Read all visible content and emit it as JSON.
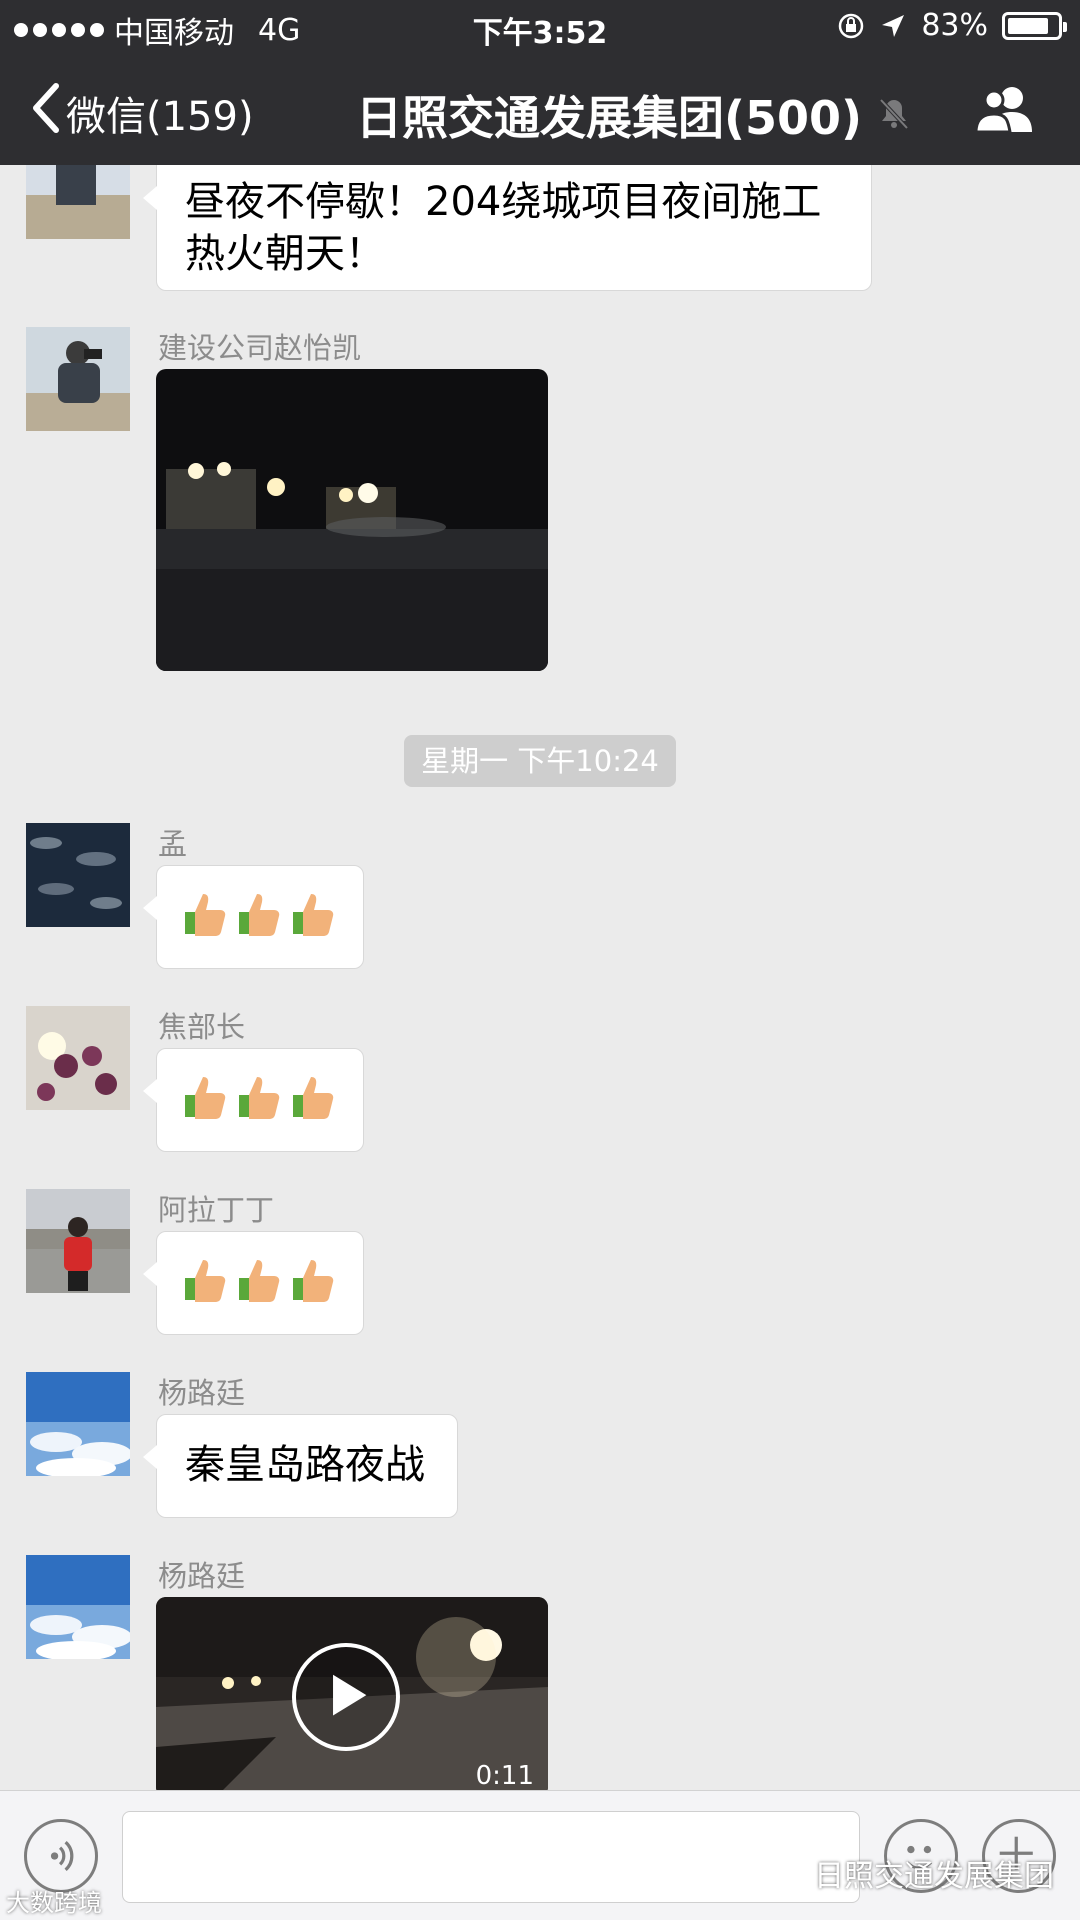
{
  "status_bar": {
    "carrier": "中国移动",
    "network": "4G",
    "time": "下午3:52",
    "battery": "83%",
    "battery_level": 0.83
  },
  "nav": {
    "back_label": "微信(159)",
    "title": "日照交通发展集团(500)",
    "icons": [
      "chevron-left-icon",
      "bell-muted-icon",
      "group-members-icon"
    ]
  },
  "messages": [
    {
      "type": "text",
      "text": "昼夜不停歇！204绕城项目夜间施工热火朝天！",
      "line1": "昼夜不停歇！204绕城项目夜间施工",
      "line2": "热火朝天！"
    },
    {
      "type": "image",
      "sender": "建设公司赵怡凯"
    },
    {
      "type": "timestamp",
      "text": "星期一 下午10:24"
    },
    {
      "type": "emoji",
      "sender": "孟",
      "emoji": "thumbs-up ×3"
    },
    {
      "type": "emoji",
      "sender": "焦部长",
      "emoji": "thumbs-up ×3"
    },
    {
      "type": "emoji",
      "sender": "阿拉丁丁",
      "emoji": "thumbs-up ×3"
    },
    {
      "type": "text",
      "sender": "杨路廷",
      "text": "秦皇岛路夜战"
    },
    {
      "type": "video",
      "sender": "杨路廷",
      "duration": "0:11"
    }
  ],
  "input_bar": {
    "icons": [
      "voice-icon",
      "emoji-icon",
      "plus-icon"
    ]
  },
  "watermark": {
    "text": "日照交通发展集团",
    "corner_text": "大数跨境"
  },
  "colors": {
    "header_bg": "#2e2e31",
    "chat_bg": "#ebebeb",
    "bubble_bg": "#ffffff",
    "timestamp_bg": "#cecece"
  }
}
